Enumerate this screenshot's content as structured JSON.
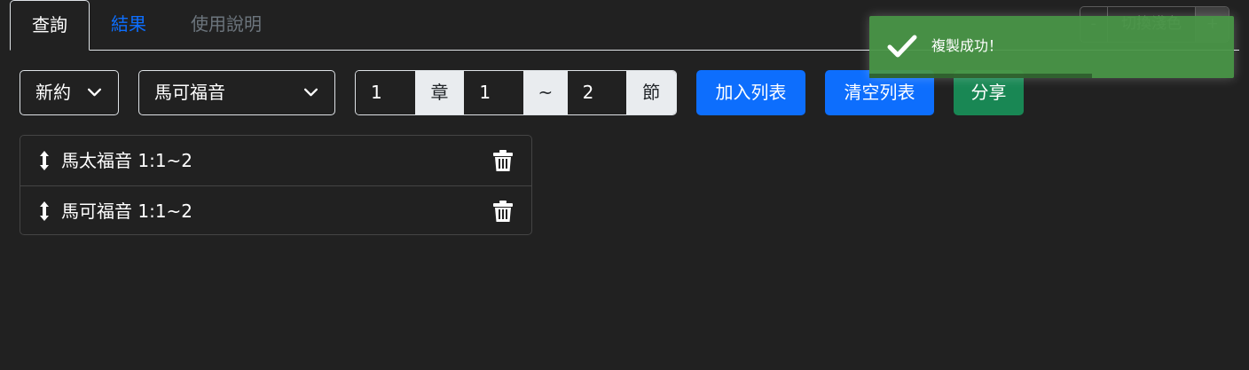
{
  "tabs": [
    {
      "label": "查詢",
      "active": true
    },
    {
      "label": "結果",
      "active": false
    },
    {
      "label": "使用說明",
      "active": false
    }
  ],
  "theme": {
    "minus_label": "-",
    "toggle_label": "切換淺色",
    "plus_label": "+"
  },
  "toolbar": {
    "testament": "新約",
    "book": "馬可福音",
    "chapter": "1",
    "chapter_unit": "章",
    "verse_start": "1",
    "range_sep": "~",
    "verse_end": "2",
    "verse_unit": "節",
    "add_label": "加入列表",
    "clear_label": "清空列表",
    "share_label": "分享"
  },
  "list": {
    "items": [
      {
        "label": "馬太福音 1:1~2"
      },
      {
        "label": "馬可福音 1:1~2"
      }
    ]
  },
  "toast": {
    "message": "複製成功！",
    "progress": 0.61
  },
  "colors": {
    "background": "#212121",
    "primary": "#0d6efd",
    "success": "#198754",
    "toast": "#4a9648",
    "muted": "#6c757d"
  }
}
